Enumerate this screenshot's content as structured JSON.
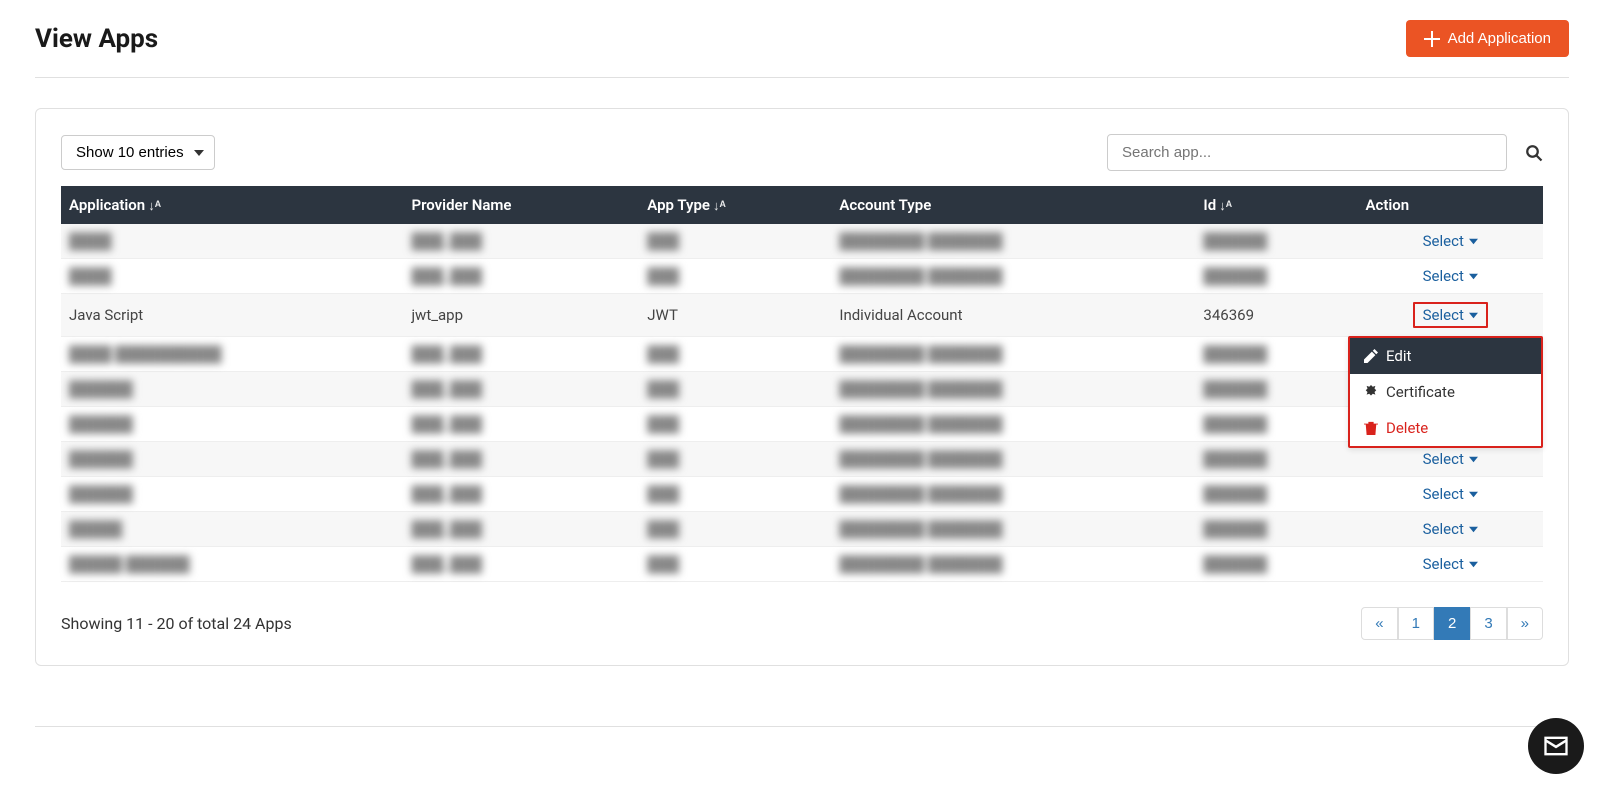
{
  "header": {
    "title": "View Apps",
    "add_button": "Add Application"
  },
  "controls": {
    "entries_label": "Show 10 entries",
    "search_placeholder": "Search app..."
  },
  "table": {
    "columns": {
      "application": "Application",
      "provider": "Provider Name",
      "app_type": "App Type",
      "account_type": "Account Type",
      "id": "Id",
      "action": "Action"
    },
    "action_label": "Select",
    "rows": [
      {
        "blurred": true,
        "application": "████",
        "provider": "███_███",
        "app_type": "███",
        "account_type": "████████ ███████",
        "id": "██████"
      },
      {
        "blurred": true,
        "application": "████",
        "provider": "███_███",
        "app_type": "███",
        "account_type": "████████ ███████",
        "id": "██████"
      },
      {
        "blurred": false,
        "application": "Java Script",
        "provider": "jwt_app",
        "app_type": "JWT",
        "account_type": "Individual Account",
        "id": "346369",
        "dropdown_open": true
      },
      {
        "blurred": true,
        "application": "████ ██████████",
        "provider": "███_███",
        "app_type": "███",
        "account_type": "████████ ███████",
        "id": "██████"
      },
      {
        "blurred": true,
        "application": "██████",
        "provider": "███_███",
        "app_type": "███",
        "account_type": "████████ ███████",
        "id": "██████"
      },
      {
        "blurred": true,
        "application": "██████",
        "provider": "███_███",
        "app_type": "███",
        "account_type": "████████ ███████",
        "id": "██████"
      },
      {
        "blurred": true,
        "application": "██████",
        "provider": "███_███",
        "app_type": "███",
        "account_type": "████████ ███████",
        "id": "██████"
      },
      {
        "blurred": true,
        "application": "██████",
        "provider": "███_███",
        "app_type": "███",
        "account_type": "████████ ███████",
        "id": "██████"
      },
      {
        "blurred": true,
        "application": "█████",
        "provider": "███_███",
        "app_type": "███",
        "account_type": "████████ ███████",
        "id": "██████"
      },
      {
        "blurred": true,
        "application": "█████ ██████",
        "provider": "███_███",
        "app_type": "███",
        "account_type": "████████ ███████",
        "id": "██████"
      }
    ]
  },
  "dropdown": {
    "edit": "Edit",
    "certificate": "Certificate",
    "delete": "Delete"
  },
  "footer": {
    "summary": "Showing 11 - 20 of total 24 Apps"
  },
  "pagination": {
    "prev": "«",
    "pages": [
      "1",
      "2",
      "3"
    ],
    "active_index": 1,
    "next": "»"
  }
}
